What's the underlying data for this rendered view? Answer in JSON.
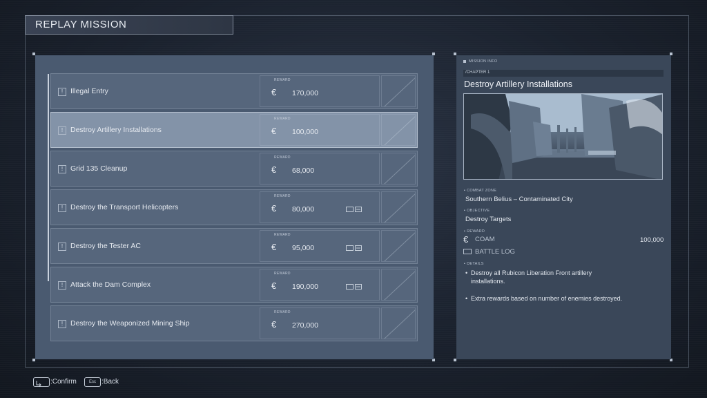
{
  "header": {
    "title": "REPLAY MISSION"
  },
  "missions": [
    {
      "name": "Illegal Entry",
      "reward_label": "REWARD",
      "currency": "€",
      "reward": "170,000",
      "log": false
    },
    {
      "name": "Destroy Artillery Installations",
      "reward_label": "REWARD",
      "currency": "€",
      "reward": "100,000",
      "log": false
    },
    {
      "name": "Grid 135 Cleanup",
      "reward_label": "REWARD",
      "currency": "€",
      "reward": "68,000",
      "log": false
    },
    {
      "name": "Destroy the Transport Helicopters",
      "reward_label": "REWARD",
      "currency": "€",
      "reward": "80,000",
      "log": true
    },
    {
      "name": "Destroy the Tester AC",
      "reward_label": "REWARD",
      "currency": "€",
      "reward": "95,000",
      "log": true
    },
    {
      "name": "Attack the Dam Complex",
      "reward_label": "REWARD",
      "currency": "€",
      "reward": "190,000",
      "log": true
    },
    {
      "name": "Destroy the Weaponized Mining Ship",
      "reward_label": "REWARD",
      "currency": "€",
      "reward": "270,000",
      "log": false
    }
  ],
  "selected_index": 1,
  "info": {
    "section_label": "MISSION INFO",
    "chapter": "/CHAPTER 1",
    "title": "Destroy Artillery Installations",
    "zone_label": "COMBAT ZONE",
    "zone": "Southern Belius – Contaminated City",
    "objective_label": "OBJECTIVE",
    "objective": "Destroy Targets",
    "reward_label": "REWARD",
    "currency": "€",
    "coam_label": "COAM",
    "coam_value": "100,000",
    "battle_log": "BATTLE LOG",
    "details_label": "DETAILS",
    "details": [
      "Destroy all Rubicon Liberation Front artillery installations.",
      "Extra rewards based on number of enemies destroyed."
    ]
  },
  "footer": {
    "confirm": ":Confirm",
    "back_key": "Esc",
    "back": ":Back"
  }
}
